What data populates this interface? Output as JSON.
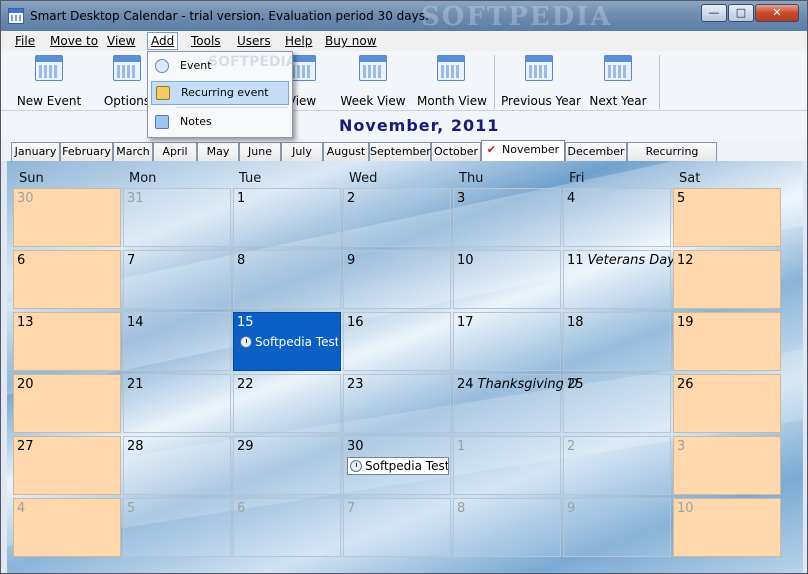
{
  "window": {
    "title": "Smart Desktop Calendar - trial version. Evaluation period 30 days.",
    "watermark": "SOFTPEDIA"
  },
  "window_controls": {
    "minimize": "—",
    "maximize": "□",
    "close": "✕"
  },
  "menubar": [
    "File",
    "Move to",
    "View",
    "Add",
    "Tools",
    "Users",
    "Help",
    "Buy now"
  ],
  "toolbar": {
    "new_event": "New Event",
    "options": "Options",
    "day_view": "View",
    "week_view": "Week View",
    "month_view": "Month View",
    "previous_year": "Previous Year",
    "next_year": "Next Year"
  },
  "add_menu": {
    "event": "Event",
    "recurring_event": "Recurring event",
    "notes": "Notes",
    "watermark": "SOFTPEDIA"
  },
  "calendar": {
    "title": "November, 2011",
    "tabs": [
      "January",
      "February",
      "March",
      "April",
      "May",
      "June",
      "July",
      "August",
      "September",
      "October",
      "November",
      "December",
      "Recurring Events"
    ],
    "active_tab": "November",
    "weekdays": [
      "Sun",
      "Mon",
      "Tue",
      "Wed",
      "Thu",
      "Fri",
      "Sat"
    ],
    "weeks": [
      [
        {
          "d": "30",
          "o": true
        },
        {
          "d": "31",
          "o": true
        },
        {
          "d": "1"
        },
        {
          "d": "2"
        },
        {
          "d": "3"
        },
        {
          "d": "4"
        },
        {
          "d": "5"
        }
      ],
      [
        {
          "d": "6"
        },
        {
          "d": "7"
        },
        {
          "d": "8"
        },
        {
          "d": "9"
        },
        {
          "d": "10"
        },
        {
          "d": "11",
          "h": "Veterans Day"
        },
        {
          "d": "12"
        }
      ],
      [
        {
          "d": "13"
        },
        {
          "d": "14"
        },
        {
          "d": "15",
          "s": true,
          "e": "Softpedia Testi"
        },
        {
          "d": "16"
        },
        {
          "d": "17"
        },
        {
          "d": "18"
        },
        {
          "d": "19"
        }
      ],
      [
        {
          "d": "20"
        },
        {
          "d": "21"
        },
        {
          "d": "22"
        },
        {
          "d": "23"
        },
        {
          "d": "24",
          "h": "Thanksgiving D"
        },
        {
          "d": "25"
        },
        {
          "d": "26"
        }
      ],
      [
        {
          "d": "27"
        },
        {
          "d": "28"
        },
        {
          "d": "29"
        },
        {
          "d": "30",
          "e": "Softpedia Test"
        },
        {
          "d": "1",
          "o": true
        },
        {
          "d": "2",
          "o": true
        },
        {
          "d": "3",
          "o": true
        }
      ],
      [
        {
          "d": "4",
          "o": true
        },
        {
          "d": "5",
          "o": true
        },
        {
          "d": "6",
          "o": true
        },
        {
          "d": "7",
          "o": true
        },
        {
          "d": "8",
          "o": true
        },
        {
          "d": "9",
          "o": true
        },
        {
          "d": "10",
          "o": true
        }
      ]
    ]
  },
  "colors": {
    "weekend": "#ffd8ad",
    "selected": "#0a5fc7",
    "title": "#1a1a7a",
    "check": "#d8131b"
  }
}
